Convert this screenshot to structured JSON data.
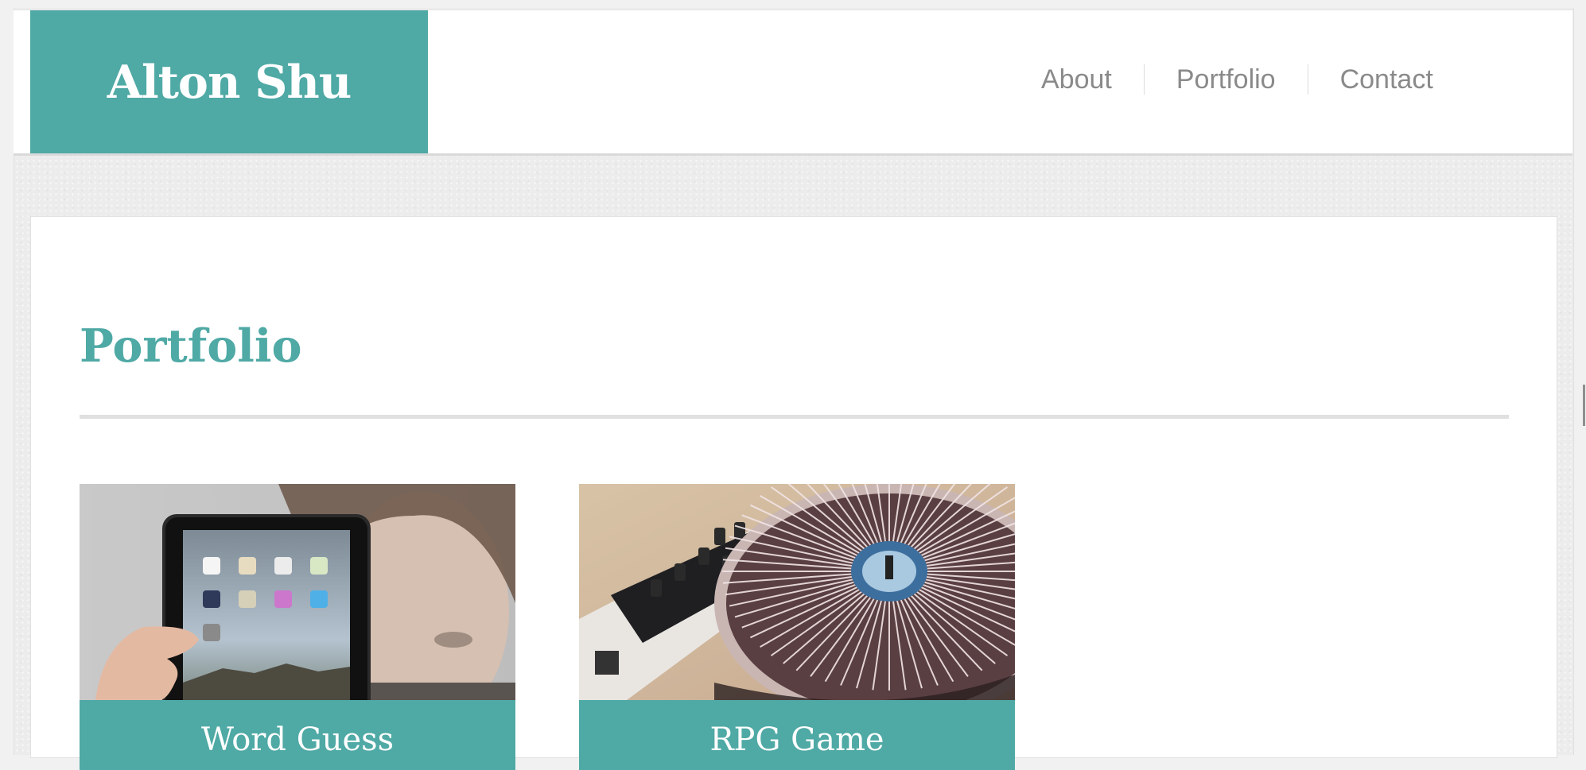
{
  "header": {
    "site_title": "Alton Shu",
    "nav": [
      {
        "label": "About"
      },
      {
        "label": "Portfolio"
      },
      {
        "label": "Contact"
      }
    ]
  },
  "main": {
    "section_title": "Portfolio",
    "projects": [
      {
        "title": "Word Guess",
        "thumbnail": "ipad-app-photo"
      },
      {
        "title": "RPG Game",
        "thumbnail": "dj-turntable-photo"
      }
    ]
  },
  "colors": {
    "accent": "#4fa9a5",
    "nav_text": "#8a8a8a",
    "page_background": "#ececec",
    "divider": "#e0e0e0"
  }
}
